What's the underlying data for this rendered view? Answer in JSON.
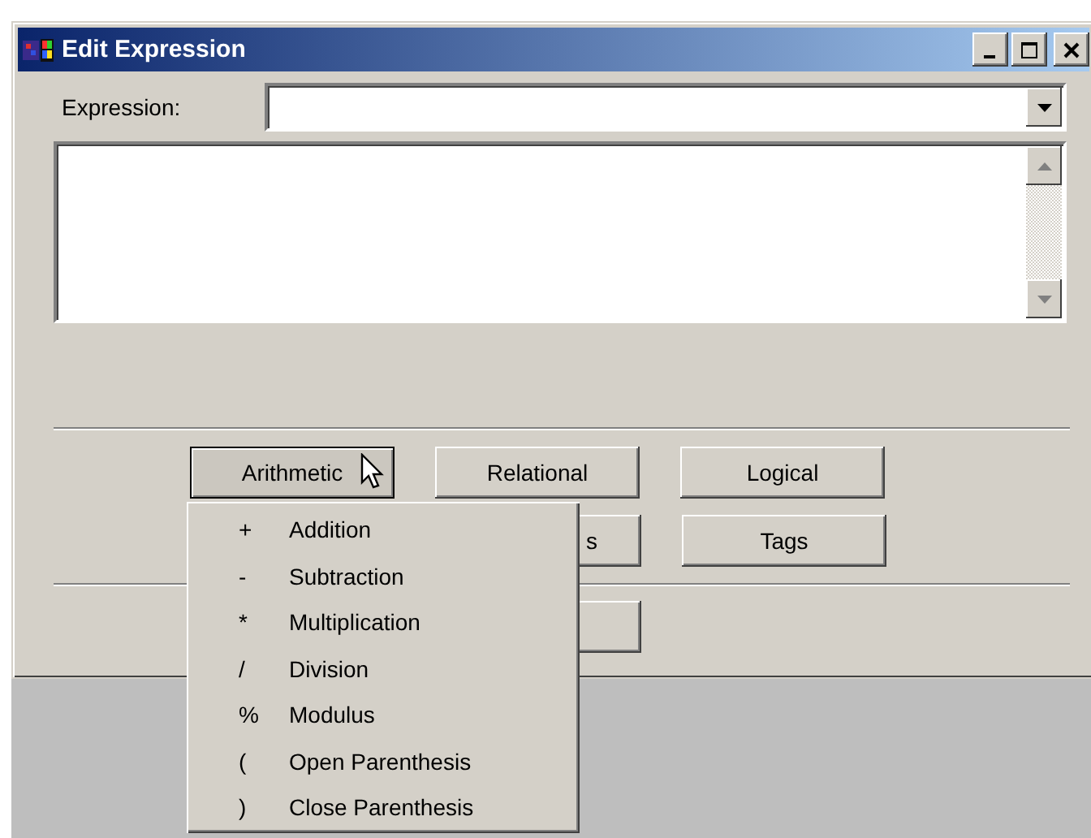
{
  "window": {
    "title": "Edit Expression"
  },
  "expression": {
    "label": "Expression:"
  },
  "button_rows": [
    [
      {
        "label": "Arithmetic",
        "pressed": true
      },
      {
        "label": "Relational",
        "pressed": false
      },
      {
        "label": "Logical",
        "pressed": false
      }
    ],
    [
      {
        "label": "s",
        "pressed": false,
        "partly_hidden": true
      },
      {
        "label": "Tags",
        "pressed": false
      }
    ],
    [
      {
        "pressed": false
      }
    ]
  ],
  "menu": {
    "items": [
      {
        "symbol": "+",
        "label": "Addition"
      },
      {
        "symbol": "-",
        "label": "Subtraction"
      },
      {
        "symbol": "*",
        "label": "Multiplication"
      },
      {
        "symbol": "/",
        "label": "Division"
      },
      {
        "symbol": "%",
        "label": "Modulus"
      },
      {
        "symbol": "(",
        "label": "Open Parenthesis"
      },
      {
        "symbol": ")",
        "label": "Close Parenthesis"
      }
    ]
  }
}
